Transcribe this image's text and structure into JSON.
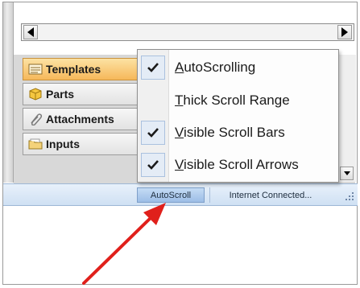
{
  "nav_tabs": [
    {
      "label": "Templates",
      "icon": "templates-icon",
      "active": true
    },
    {
      "label": "Parts",
      "icon": "parts-cube-icon",
      "active": false
    },
    {
      "label": "Attachments",
      "icon": "paperclip-icon",
      "active": false
    },
    {
      "label": "Inputs",
      "icon": "folder-icon",
      "active": false
    }
  ],
  "context_menu": {
    "items": [
      {
        "label": "AutoScrolling",
        "checked": true
      },
      {
        "label": "Thick Scroll Range",
        "checked": false
      },
      {
        "label": "Visible Scroll Bars",
        "checked": true
      },
      {
        "label": "Visible Scroll Arrows",
        "checked": true
      }
    ]
  },
  "statusbar": {
    "autoscroll_label": "AutoScroll",
    "connection_label": "Internet Connected..."
  },
  "colors": {
    "active_tab": "#f6b85a",
    "statusbar": "#cfe0f3",
    "annotation_arrow": "#e0201b"
  }
}
